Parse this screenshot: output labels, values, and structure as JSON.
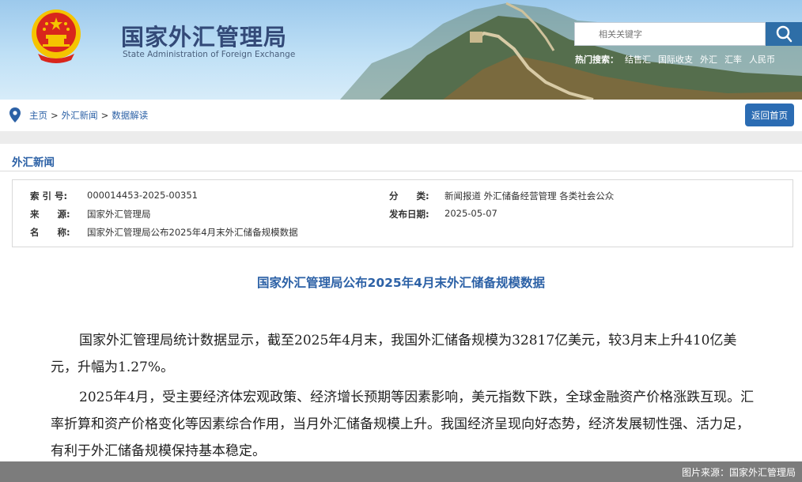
{
  "header": {
    "title_cn": "国家外汇管理局",
    "title_en": "State Administration of Foreign Exchange",
    "search_placeholder": "相关关键字",
    "hot_label": "热门搜索：",
    "hot_keywords": [
      "结售汇",
      "国际收支",
      "外汇",
      "汇率",
      "人民币"
    ]
  },
  "breadcrumb": {
    "items": [
      "主页",
      "外汇新闻",
      "数据解读"
    ],
    "separator": ">"
  },
  "back_button": "返回首页",
  "section_title": "外汇新闻",
  "meta": {
    "index_label": "索 引 号:",
    "index_value": "000014453-2025-00351",
    "category_label": "分　　类:",
    "category_value": "新闻报道  外汇储备经营管理  各类社会公众",
    "source_label": "来　　源:",
    "source_value": "国家外汇管理局",
    "date_label": "发布日期:",
    "date_value": "2025-05-07",
    "name_label": "名　　称:",
    "name_value": "国家外汇管理局公布2025年4月末外汇储备规模数据"
  },
  "article": {
    "title": "国家外汇管理局公布2025年4月末外汇储备规模数据",
    "paragraphs": [
      "国家外汇管理局统计数据显示，截至2025年4月末，我国外汇储备规模为32817亿美元，较3月末上升410亿美元，升幅为1.27%。",
      "2025年4月，受主要经济体宏观政策、经济增长预期等因素影响，美元指数下跌，全球金融资产价格涨跌互现。汇率折算和资产价格变化等因素综合作用，当月外汇储备规模上升。我国经济呈现向好态势，经济发展韧性强、活力足，有利于外汇储备规模保持基本稳定。"
    ]
  },
  "footer": {
    "caption": "图片来源：国家外汇管理局"
  },
  "colors": {
    "brand_blue": "#2c61a6",
    "button_blue": "#2b6cb3",
    "emblem_red": "#d9261c",
    "emblem_gold": "#f5c400"
  }
}
